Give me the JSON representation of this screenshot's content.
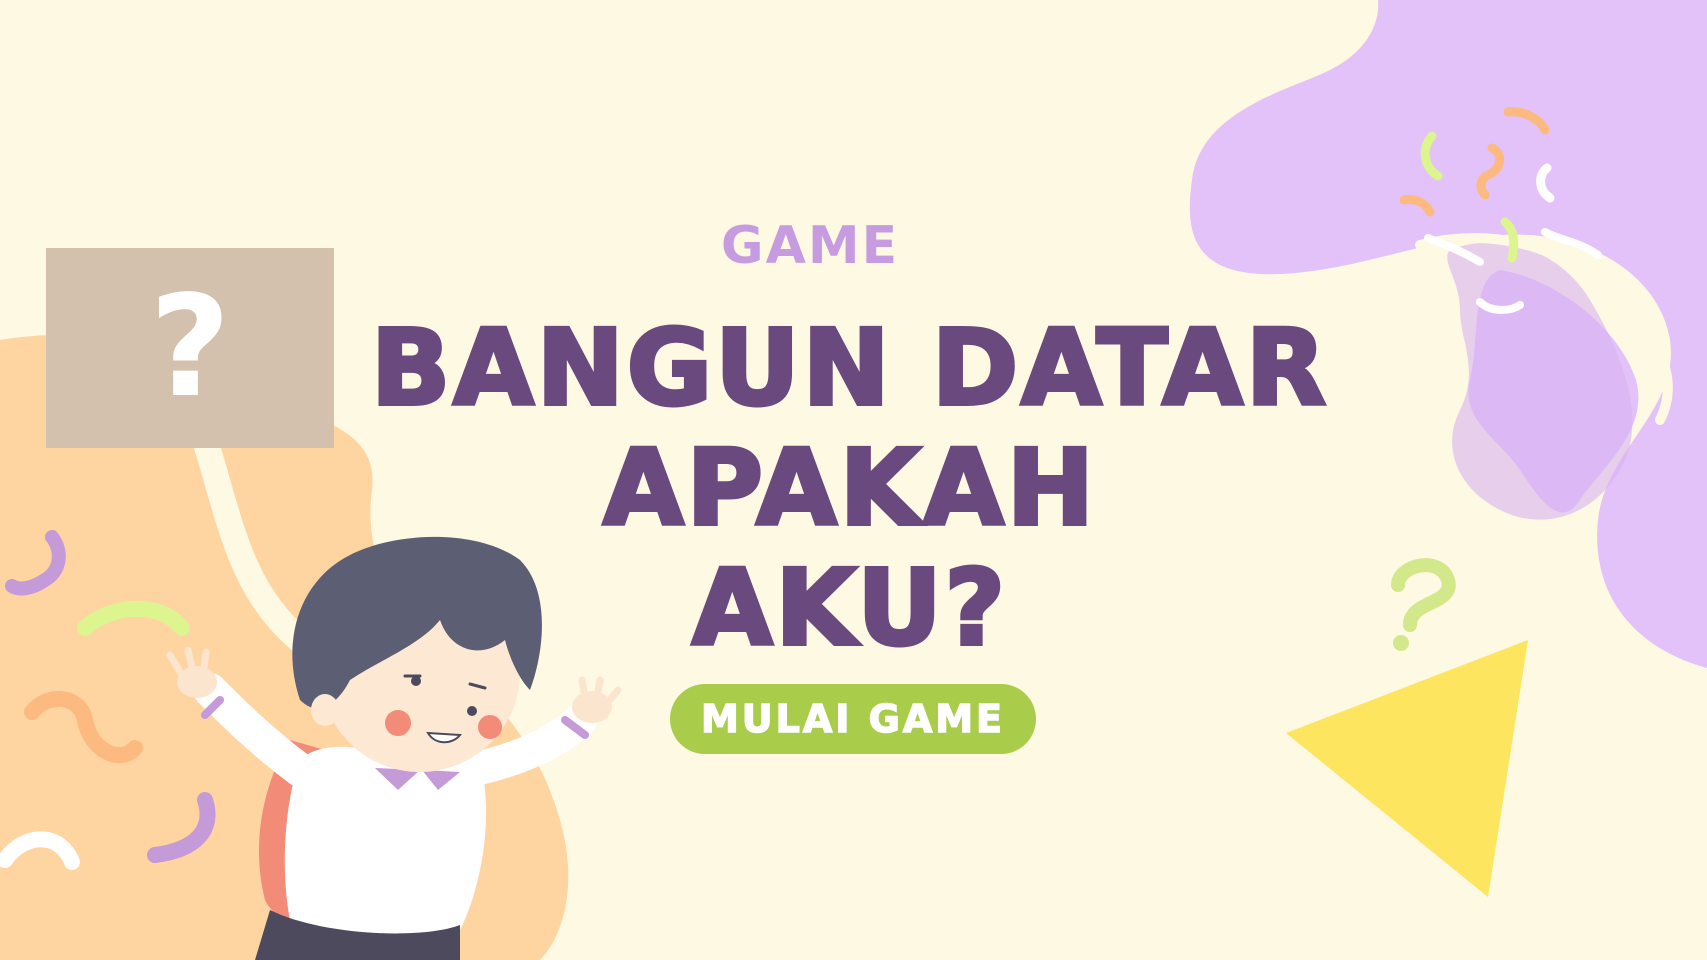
{
  "screen": {
    "eyebrow": "GAME",
    "title_lines": [
      "BANGUN DATAR",
      "APAKAH",
      "AKU?"
    ]
  },
  "start_button": {
    "label": "MULAI GAME"
  },
  "mystery_card": {
    "symbol": "?"
  },
  "colors": {
    "background": "#fdf9e3",
    "title": "#6a4a7e",
    "eyebrow": "#c79bdf",
    "button": "#a9cc4a",
    "card": "#d3c1ad",
    "peach_blob": "#fed4a1",
    "purple_blob": "#e2c2f8",
    "triangle": "#fde55f"
  },
  "illustration": {
    "character": "child-with-backpack-icon",
    "decorations": [
      "squiggle-icon",
      "question-mark-icon",
      "triangle-icon"
    ]
  }
}
